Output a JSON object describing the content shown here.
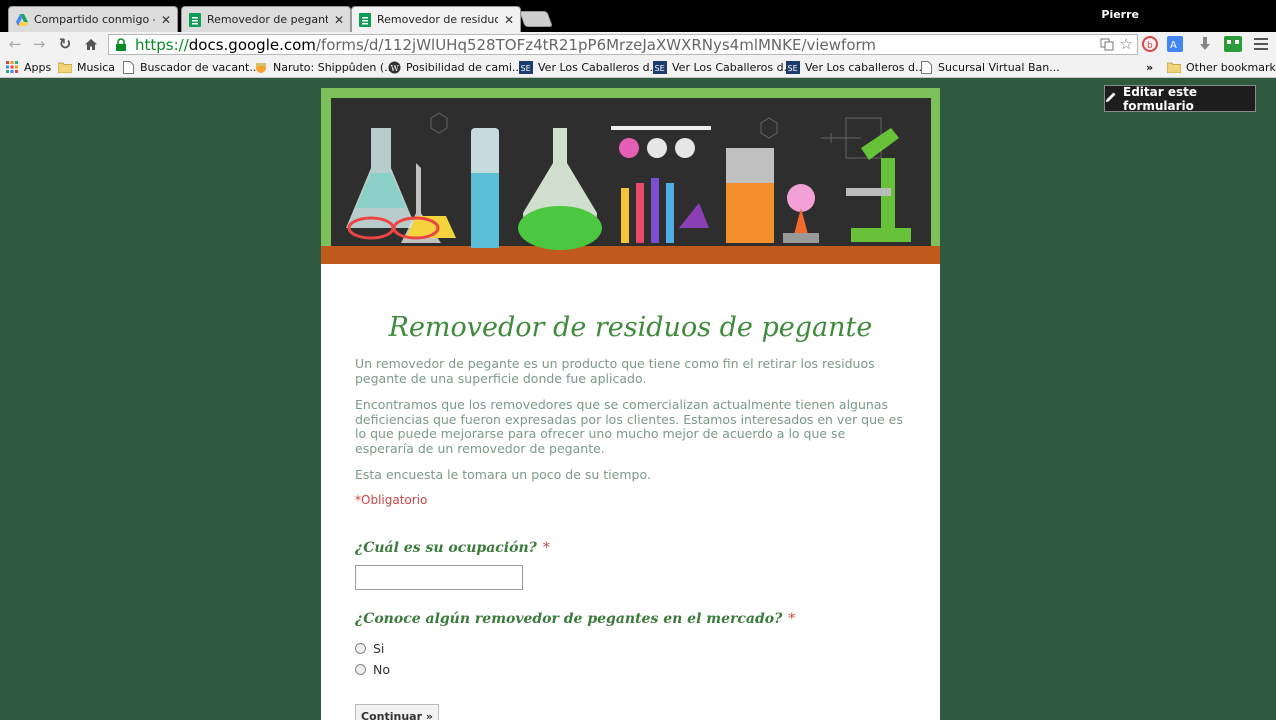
{
  "browser": {
    "tabs": [
      {
        "label": "Compartido conmigo - Go",
        "icon": "google-drive-icon"
      },
      {
        "label": "Removedor de pegante -",
        "icon": "google-forms-icon"
      },
      {
        "label": "Removedor de residuos d",
        "icon": "google-forms-icon"
      }
    ],
    "profile_name": "Pierre",
    "url": {
      "scheme": "https://",
      "host": "docs.google.com",
      "path": "/forms/d/112jWlUHq528TOFz4tR21pP6MrzeJaXWXRNys4mlMNKE/viewform"
    },
    "bookmarks": [
      {
        "label": "Apps",
        "icon": "apps-grid-icon"
      },
      {
        "label": "Musica",
        "icon": "folder-icon"
      },
      {
        "label": "Buscador de vacant...",
        "icon": "page-icon"
      },
      {
        "label": "Naruto: Shippûden (...",
        "icon": "naruto-icon"
      },
      {
        "label": "Posibilidad de cami...",
        "icon": "wordpress-icon"
      },
      {
        "label": "Ver Los Caballeros d...",
        "icon": "se-icon"
      },
      {
        "label": "Ver Los Caballeros d...",
        "icon": "se-icon"
      },
      {
        "label": "Ver Los caballeros d...",
        "icon": "se-icon"
      },
      {
        "label": "Sucursal Virtual Ban...",
        "icon": "page-icon"
      }
    ],
    "overflow_label": "»",
    "other_bookmarks": "Other bookmarks"
  },
  "page": {
    "edit_button": "Editar este formulario",
    "form_title": "Removedor de residuos de pegante",
    "description": [
      "Un removedor de pegante es un producto que tiene como fin el retirar los residuos pegante de una superficie donde fue aplicado.",
      "Encontramos que los removedores que se comercializan actualmente tienen algunas deficiencias que fueron expresadas por los clientes. Estamos interesados en ver que es lo que puede mejorarse para ofrecer uno mucho mejor de acuerdo a lo que se esperaría de un removedor de pegante.",
      "Esta encuesta le tomara un poco de su tiempo."
    ],
    "required_note": "*Obligatorio",
    "questions": [
      {
        "title": "¿Cuál es su ocupación?",
        "required_mark": "*",
        "type": "text",
        "value": ""
      },
      {
        "title": "¿Conoce algún removedor de pegantes en el mercado?",
        "required_mark": "*",
        "type": "radio",
        "options": [
          "Si",
          "No"
        ]
      }
    ],
    "continue_button": "Continuar »"
  },
  "colors": {
    "background": "#2f5a3f",
    "title_green": "#3e8b3c",
    "required_red": "#c44"
  }
}
